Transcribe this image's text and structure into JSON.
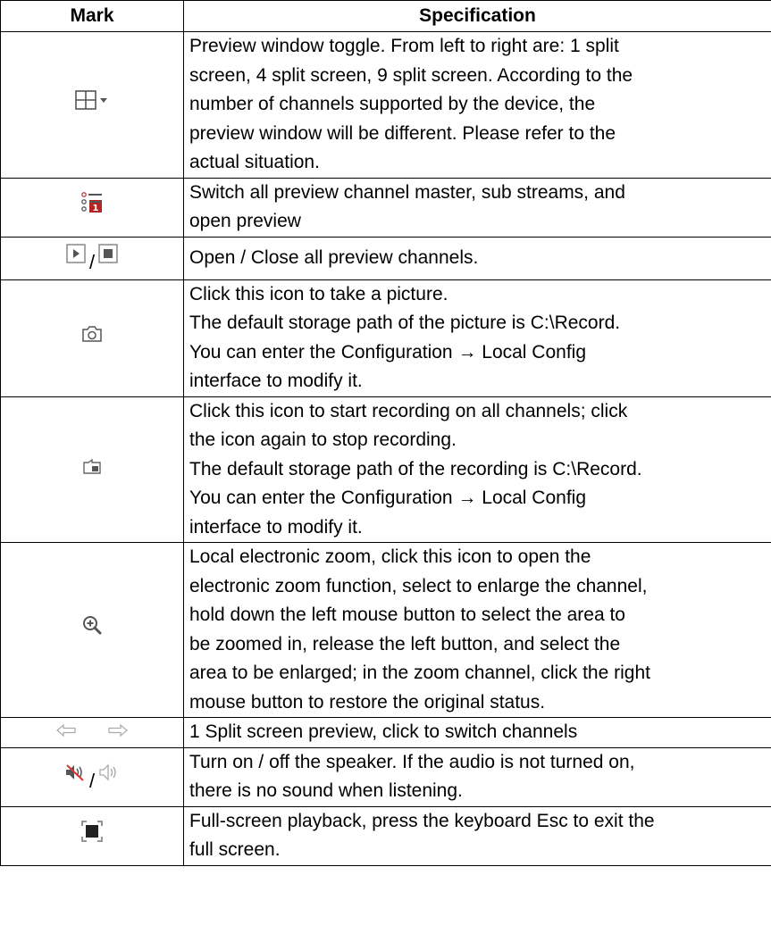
{
  "table": {
    "headers": {
      "mark": "Mark",
      "specification": "Specification"
    },
    "rows": [
      {
        "icons": [
          "split-screen-grid-icon",
          "dropdown-caret-icon"
        ],
        "lines": [
          "Preview window toggle. From left to right are: 1 split",
          "screen, 4 split screen, 9 split screen. According to the",
          "number of channels supported by the device, the",
          "preview window will be different. Please refer to the",
          "actual situation."
        ]
      },
      {
        "icons": [
          "stream-switch-list-icon"
        ],
        "lines": [
          "Switch all preview channel master, sub streams, and",
          "open preview"
        ]
      },
      {
        "icons": [
          "play-square-icon",
          "stop-square-icon"
        ],
        "separator": "/",
        "lines": [
          "Open / Close all preview channels."
        ]
      },
      {
        "icons": [
          "camera-icon"
        ],
        "lines": [
          "Click this icon to take a picture.",
          "The default storage path of the picture is C:\\Record.",
          "You can enter the Configuration → Local Config",
          "interface to modify it."
        ]
      },
      {
        "icons": [
          "video-record-icon"
        ],
        "lines": [
          "Click this icon to start recording on all channels; click",
          "the icon again to stop recording.",
          "The default storage path of the recording is C:\\Record.",
          "You can enter the Configuration → Local Config",
          "interface to modify it."
        ]
      },
      {
        "icons": [
          "zoom-in-icon"
        ],
        "lines": [
          "Local electronic zoom, click this icon to open the",
          "electronic zoom function, select to enlarge the channel,",
          "hold down the left mouse button to select the area to",
          "be zoomed in, release the left button, and select the",
          "area to be enlarged; in the zoom channel, click the right",
          "mouse button to restore the original status."
        ]
      },
      {
        "icons": [
          "arrow-left-icon",
          "arrow-right-icon"
        ],
        "lines": [
          "1 Split screen preview, click to switch channels"
        ]
      },
      {
        "icons": [
          "speaker-muted-icon",
          "speaker-on-icon"
        ],
        "separator": "/",
        "lines": [
          "Turn on / off the speaker. If the audio is not turned on,",
          "there is no sound when listening."
        ]
      },
      {
        "icons": [
          "fullscreen-icon"
        ],
        "lines": [
          "Full-screen playback, press the keyboard Esc to exit the",
          "full screen."
        ]
      }
    ]
  }
}
